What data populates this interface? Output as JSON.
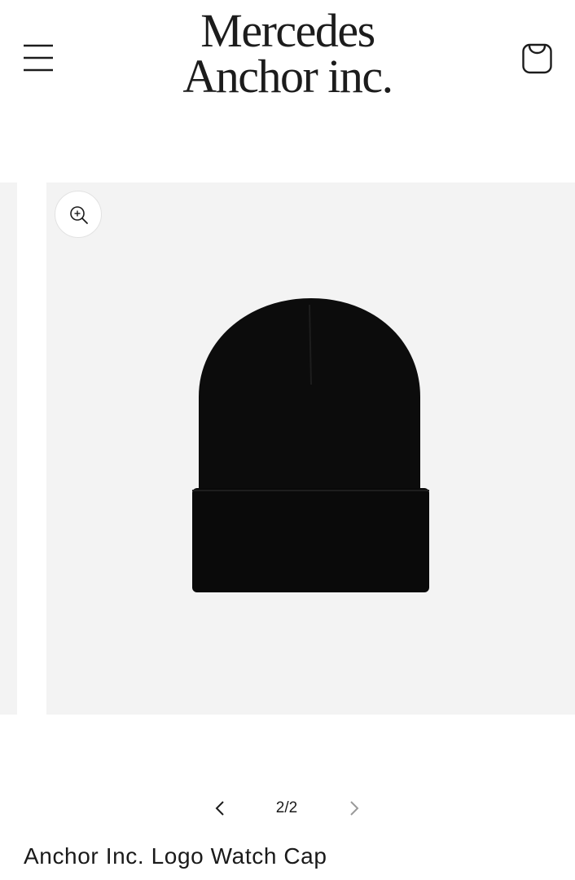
{
  "header": {
    "brand_line1": "Mercedes",
    "brand_line2": "Anchor inc.",
    "menu_icon": "hamburger-menu-icon",
    "cart_icon": "shopping-bag-icon"
  },
  "gallery": {
    "zoom_icon": "zoom-in-icon",
    "image_subject": "black-beanie",
    "counter": "2/2",
    "prev_icon": "chevron-left-icon",
    "next_icon": "chevron-right-icon",
    "background_color": "#f3f3f3"
  },
  "product": {
    "title": "Anchor Inc. Logo Watch Cap"
  }
}
